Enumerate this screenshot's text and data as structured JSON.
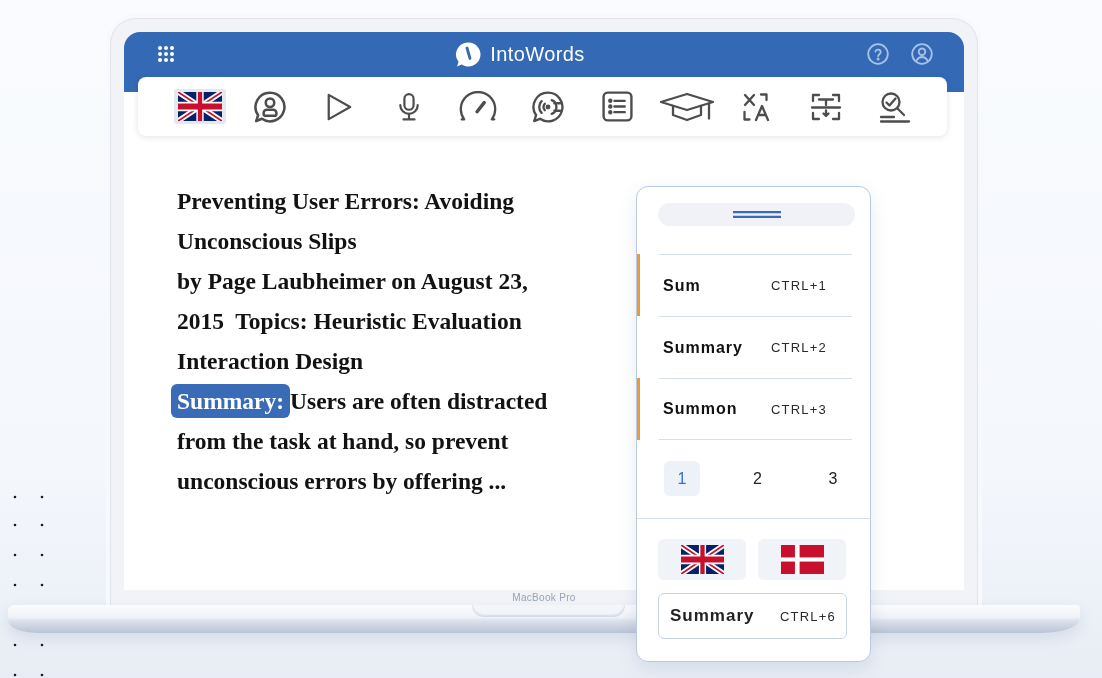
{
  "app": {
    "title": "IntoWords"
  },
  "article": {
    "title": "Preventing User Errors: Avoiding Unconscious Slips",
    "meta": "by Page Laubheimer on August 23, 2015  Topics: Heuristic Evaluation Interaction Design",
    "summary": {
      "label": "Summary:",
      "text": "Users are often distracted from the task at hand, so prevent unconscious errors by offering ..."
    }
  },
  "panel": {
    "suggestions": [
      {
        "word": "Sum",
        "shortcut": "CTRL+1",
        "marked": true
      },
      {
        "word": "Summary",
        "shortcut": "CTRL+2",
        "marked": false
      },
      {
        "word": "Summon",
        "shortcut": "CTRL+3",
        "marked": true
      }
    ],
    "pages": [
      {
        "label": "1",
        "selected": true
      },
      {
        "label": "2",
        "selected": false
      },
      {
        "label": "3",
        "selected": false
      }
    ],
    "action": {
      "label": "Summary",
      "shortcut": "CTRL+6"
    }
  },
  "device": {
    "label": "MacBook Pro"
  }
}
